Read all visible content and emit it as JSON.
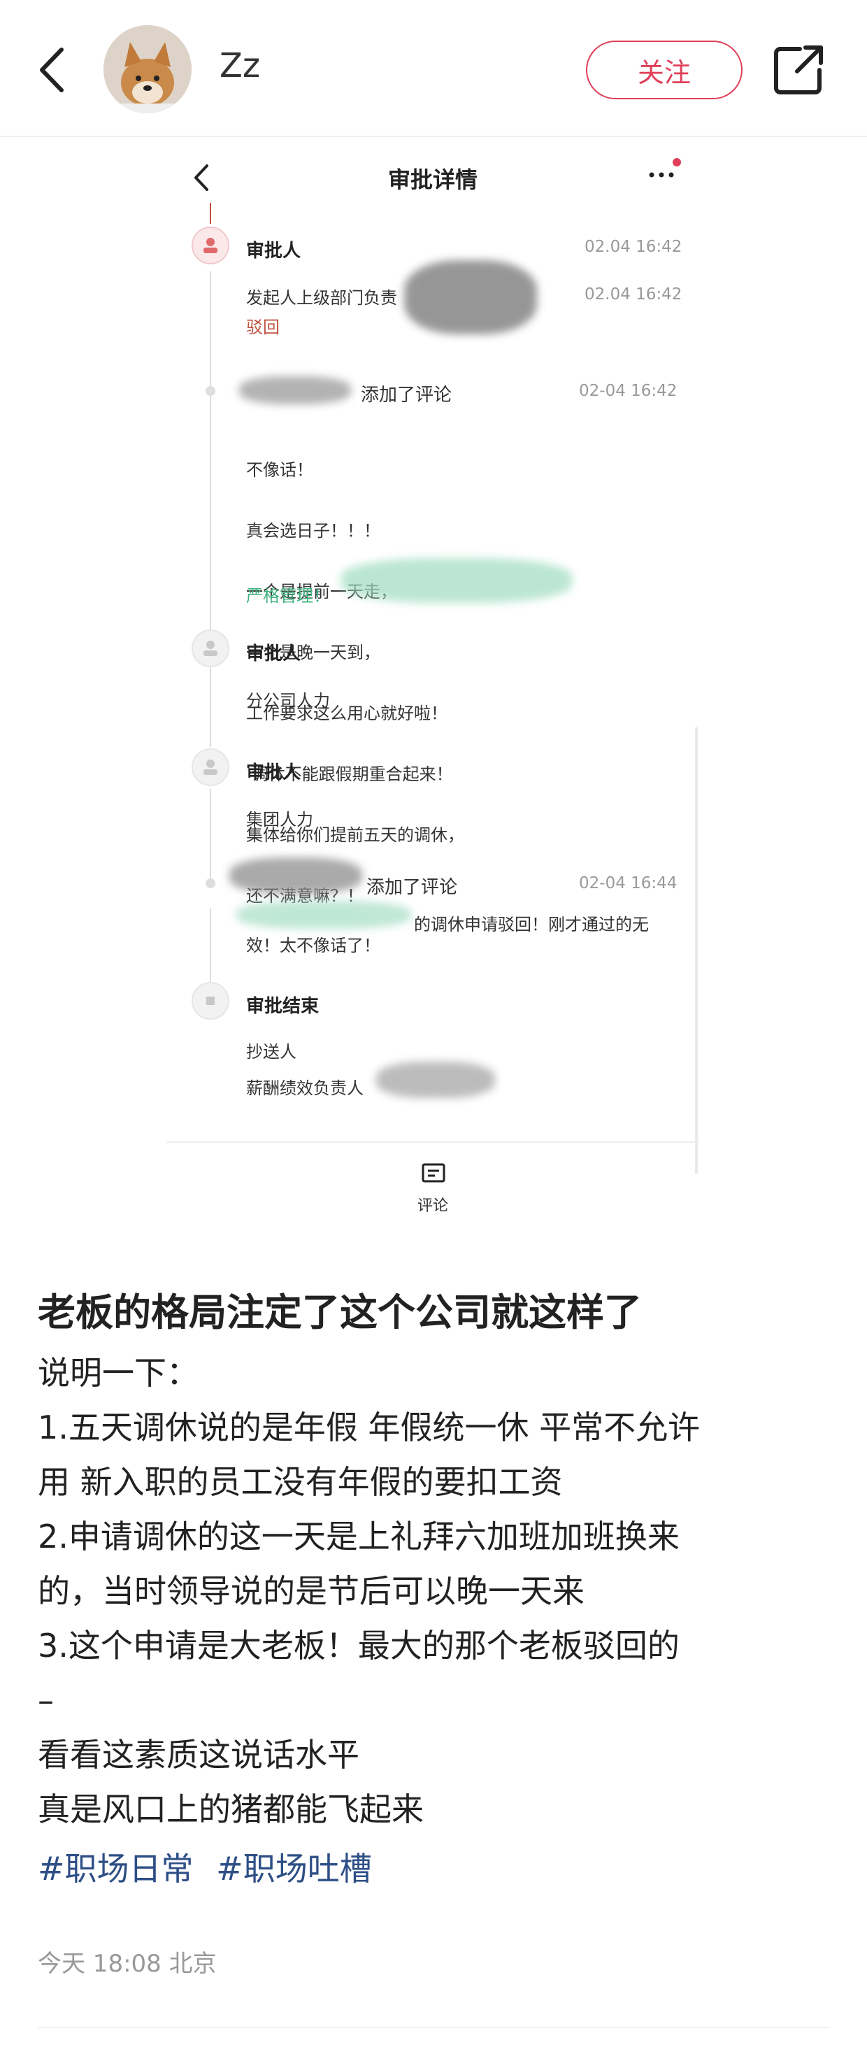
{
  "header": {
    "username": "Zz",
    "follow_label": "关注",
    "icons": {
      "back": "chevron-left-icon",
      "share": "share-icon"
    }
  },
  "screenshot": {
    "title": "审批详情",
    "comment_label": "评论",
    "timeline": [
      {
        "role": "审批人",
        "line": "发起人上级部门负责",
        "time_a": "02.04 16:42",
        "time_b": "02.04 16:42",
        "status": "驳回"
      },
      {
        "action": "添加了评论",
        "time": "02-04 16:42",
        "comment": [
          "不像话！",
          "真会选日子！！！",
          "一个是提前一天走，",
          "一个是晚一天到，",
          "工作要求这么用心就好啦！",
          " 调休不能跟假期重合起来！",
          "集体给你们提前五天的调休，",
          "还不满意嘛？！"
        ],
        "highlight": "严格管理！"
      },
      {
        "role": "审批人",
        "line": "分公司人力"
      },
      {
        "role": "审批人",
        "line": "集团人力"
      },
      {
        "action": "添加了评论",
        "time": "02-04 16:44",
        "comment_a": "的调休申请驳回！刚才通过的无",
        "comment_b": "效！太不像话了！"
      },
      {
        "role": "审批结束",
        "cc_label": "抄送人",
        "cc_line": "薪酬绩效负责人"
      }
    ]
  },
  "post": {
    "title": "老板的格局注定了这个公司就这样了",
    "lines": [
      "说明一下：",
      "1.五天调休说的是年假 年假统一休 平常不允许",
      "用 新入职的员工没有年假的要扣工资",
      "2.申请调休的这一天是上礼拜六加班加班换来",
      "的，当时领导说的是节后可以晚一天来",
      "3.这个申请是大老板！最大的那个老板驳回的",
      "–",
      "看看这素质这说话水平",
      "真是风口上的猪都能飞起来"
    ],
    "tags": [
      "#职场日常",
      "#职场吐槽"
    ],
    "meta": "今天 18:08 北京"
  },
  "colors": {
    "accent": "#e0405a",
    "tag": "#2e4f86",
    "meta": "#999999",
    "green": "#3fb27f",
    "rejected": "#c0503e"
  }
}
